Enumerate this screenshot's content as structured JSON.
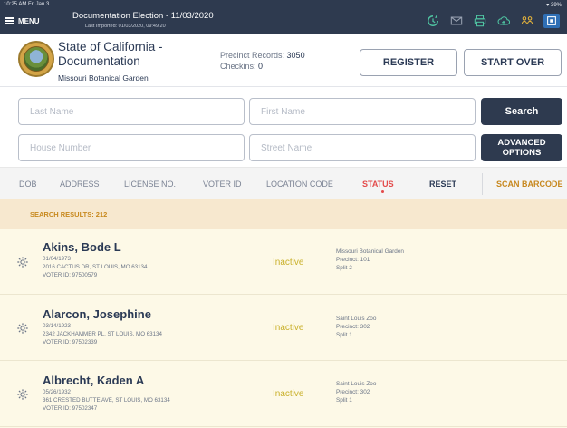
{
  "status_bar": {
    "time": "10:25 AM  Fri Jan 3",
    "battery": "39%"
  },
  "topbar": {
    "menu_label": "MENU",
    "election_title": "Documentation Election - 11/03/2020",
    "last_imported": "Last Imported: 01/03/2020, 09:49:20",
    "icons": [
      "sync-icon",
      "mail-icon",
      "printer-icon",
      "cloud-icon",
      "people-icon",
      "qr-scan-icon"
    ]
  },
  "header": {
    "org_line1": "State of California -",
    "org_line2": "Documentation",
    "location": "Missouri Botanical Garden",
    "precinct_records_label": "Precinct Records:",
    "precinct_records_value": "3050",
    "checkins_label": "Checkins:",
    "checkins_value": "0",
    "register_label": "REGISTER",
    "start_over_label": "START OVER"
  },
  "search": {
    "last_name_placeholder": "Last Name",
    "first_name_placeholder": "First Name",
    "house_number_placeholder": "House Number",
    "street_name_placeholder": "Street Name",
    "search_label": "Search",
    "advanced_line1": "ADVANCED",
    "advanced_line2": "OPTIONS"
  },
  "sort": {
    "dob": "DOB",
    "address": "ADDRESS",
    "license": "LICENSE NO.",
    "voter_id": "VOTER ID",
    "location_code": "LOCATION CODE",
    "status": "STATUS",
    "reset": "RESET",
    "scan_barcode": "SCAN BARCODE"
  },
  "results": {
    "label": "SEARCH RESULTS: 212",
    "rows": [
      {
        "name": "Akins, Bode L",
        "dob": "01/04/1973",
        "address": "2016 CACTUS DR, ST LOUIS, MO 63134",
        "voter_id": "VOTER ID: 97500579",
        "status": "Inactive",
        "location": "Missouri Botanical Garden",
        "precinct": "Precinct: 101",
        "split": "Split 2"
      },
      {
        "name": "Alarcon, Josephine",
        "dob": "03/14/1923",
        "address": "2342 JACKHAMMER PL, ST LOUIS, MO 63134",
        "voter_id": "VOTER ID: 97502339",
        "status": "Inactive",
        "location": "Saint Louis Zoo",
        "precinct": "Precinct: 302",
        "split": "Split 1"
      },
      {
        "name": "Albrecht, Kaden A",
        "dob": "05/26/1932",
        "address": "361 CRESTED BUTTE AVE, ST LOUIS, MO 63134",
        "voter_id": "VOTER ID: 97502347",
        "status": "Inactive",
        "location": "Saint Louis Zoo",
        "precinct": "Precinct: 302",
        "split": "Split 1"
      }
    ]
  },
  "colors": {
    "nav_bg": "#2e3a4f",
    "status_active": "#e34b4b",
    "results_bar": "#f7e8cf",
    "rows_bg": "#fdf9e7",
    "inactive_text": "#c9b02a",
    "scan_barcode": "#c7881f"
  }
}
